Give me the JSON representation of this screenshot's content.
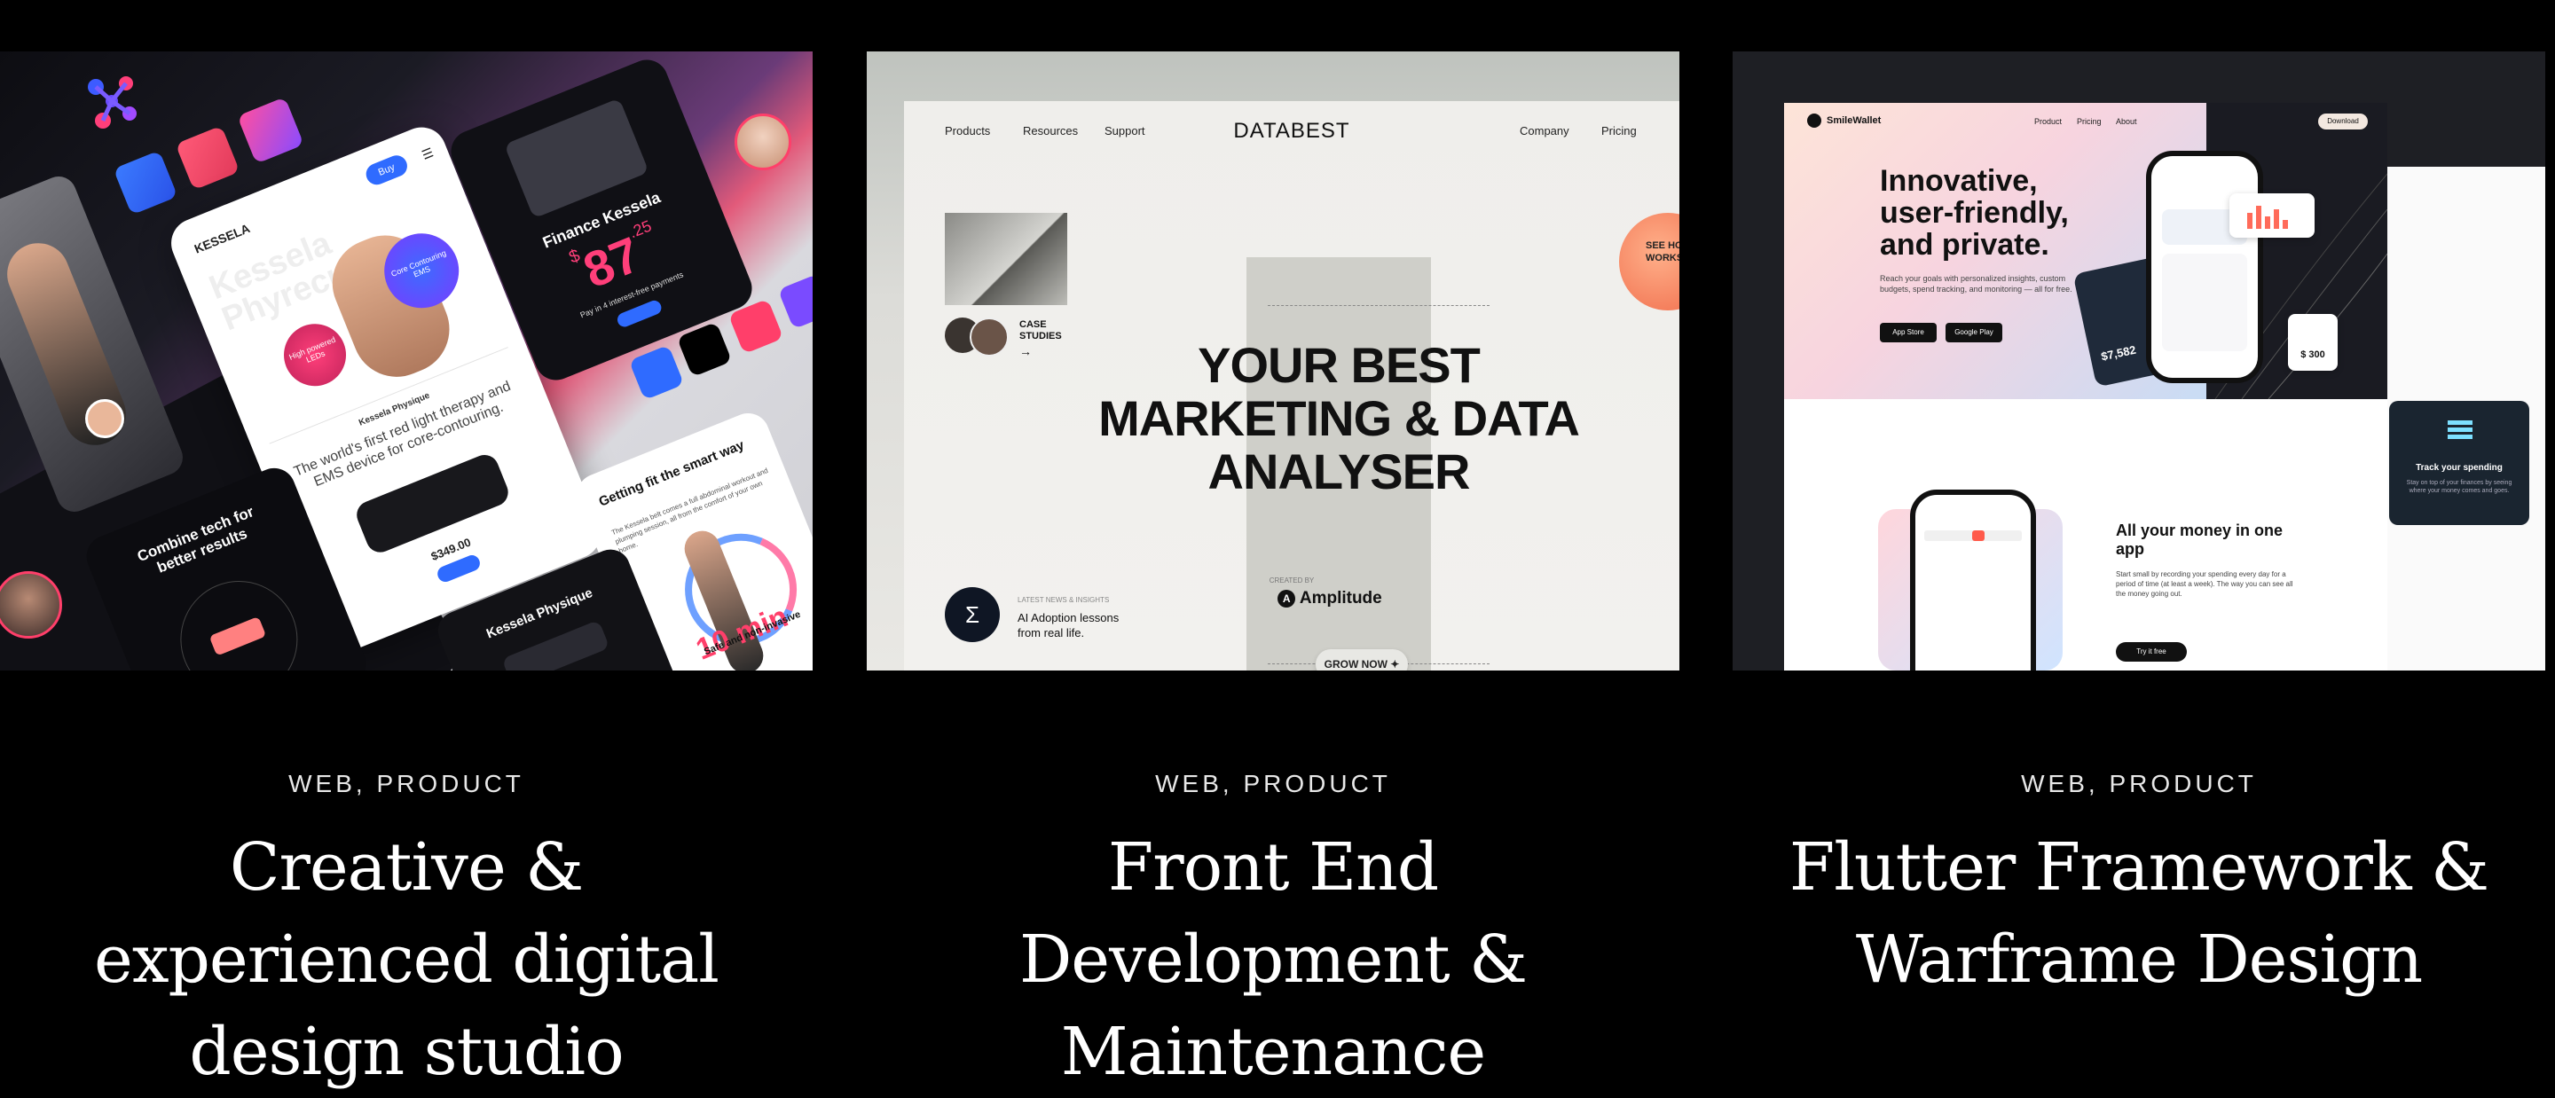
{
  "cards": [
    {
      "category": "WEB, PRODUCT",
      "title": "Creative & experienced digital design studio",
      "mockup": {
        "brand": "KESSELA",
        "buy_label": "Buy",
        "hero_word": "Kessela Phyrecue",
        "bubbles": [
          "High powered LEDs",
          "Core Contouring EMS"
        ],
        "product_name": "Kessela Physique",
        "product_tagline": "The world's first red light therapy and EMS device for core-contouring.",
        "product_price": "$349.00",
        "finance_title": "Finance Kessela",
        "finance_currency": "$",
        "finance_amount": "87",
        "finance_cents": ".25",
        "finance_note": "Pay in 4 interest-free payments",
        "combine_text": "Combine tech for better results",
        "fit_title": "Getting fit the smart way",
        "fit_body": "The Kessela belt comes a full abdominal workout and plumping session, all from the comfort of your own home.",
        "timer": "10 min",
        "physique_label": "Kessela Physique",
        "safe_label": "Safe and non-invasive"
      }
    },
    {
      "category": "WEB, PRODUCT",
      "title": "Front End Development & Maintenance",
      "mockup": {
        "nav_left": [
          "Products",
          "Resources",
          "Support"
        ],
        "logo": "DATABEST",
        "nav_right": [
          "Company",
          "Pricing"
        ],
        "headline": "YOUR BEST MARKETING & DATA ANALYSER",
        "case_studies": "CASE STUDIES",
        "see_how": "SEE HOW IT WORKS",
        "created_by": "CREATED BY",
        "partner": "Amplitude",
        "cta": "GROW NOW",
        "news_label": "LATEST NEWS & INSIGHTS",
        "news_title": "AI Adoption lessons from real life."
      }
    },
    {
      "category": "WEB, PRODUCT",
      "title": "Flutter Framework & Warframe Design",
      "mockup": {
        "brand": "SmileWallet",
        "nav": [
          "Product",
          "Pricing",
          "About"
        ],
        "download": "Download",
        "headline": "Innovative, user-friendly, and private.",
        "body": "Reach your goals with personalized insights, custom budgets, spend tracking, and monitoring — all for free.",
        "stores": [
          "App Store",
          "Google Play"
        ],
        "card_balance": "$7,582",
        "amount": "$ 300",
        "section_title": "All your money in one app",
        "section_body": "Start small by recording your spending every day for a period of time (at least a week). The way you can see all the money going out.",
        "section_cta": "Try it free",
        "track_title": "Track your spending",
        "track_body": "Stay on top of your finances by seeing where your money comes and goes."
      }
    }
  ],
  "colors": {
    "background": "#000000",
    "accent_pink": "#ff3f7a",
    "accent_blue": "#2f6bff",
    "coral": "#f06b4a"
  }
}
